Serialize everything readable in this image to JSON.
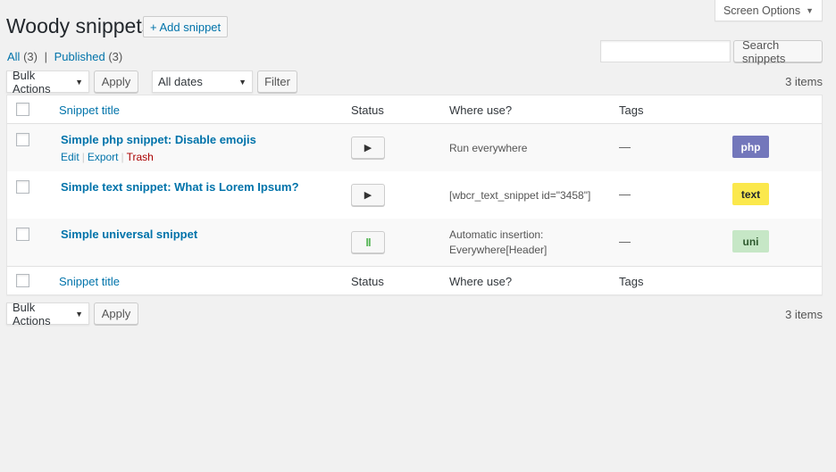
{
  "header": {
    "screen_options": "Screen Options",
    "title": "Woody snippets",
    "add_new": "+ Add snippet"
  },
  "views": {
    "all_label": "All",
    "all_count": "(3)",
    "separator": "|",
    "published_label": "Published",
    "published_count": "(3)"
  },
  "search": {
    "value": "",
    "button": "Search snippets"
  },
  "tablenav": {
    "bulk_actions": "Bulk Actions",
    "apply": "Apply",
    "dates": "All dates",
    "filter": "Filter",
    "items": "3 items"
  },
  "columns": {
    "title": "Snippet title",
    "status": "Status",
    "where": "Where use?",
    "tags": "Tags"
  },
  "rows": [
    {
      "title": "Simple php snippet: Disable emojis",
      "actions": {
        "edit": "Edit",
        "export": "Export",
        "trash": "Trash"
      },
      "status_icon": "▶",
      "where_line1": "Run everywhere",
      "where_line2": "",
      "tags": "—",
      "type": "php",
      "badge_bg": "#7377bb",
      "badge_fg": "#ffffff"
    },
    {
      "title": "Simple text snippet: What is Lorem Ipsum?",
      "status_icon": "▶",
      "where_line1": "[wbcr_text_snippet id=\"3458\"]",
      "where_line2": "",
      "tags": "—",
      "type": "text",
      "badge_bg": "#fbe84c",
      "badge_fg": "#23282d"
    },
    {
      "title": "Simple universal snippet",
      "status_icon": "II",
      "where_line1": "Automatic insertion:",
      "where_line2": "Everywhere[Header]",
      "tags": "—",
      "type": "uni",
      "badge_bg": "#c6e7c6",
      "badge_fg": "#2f5b2f"
    }
  ]
}
